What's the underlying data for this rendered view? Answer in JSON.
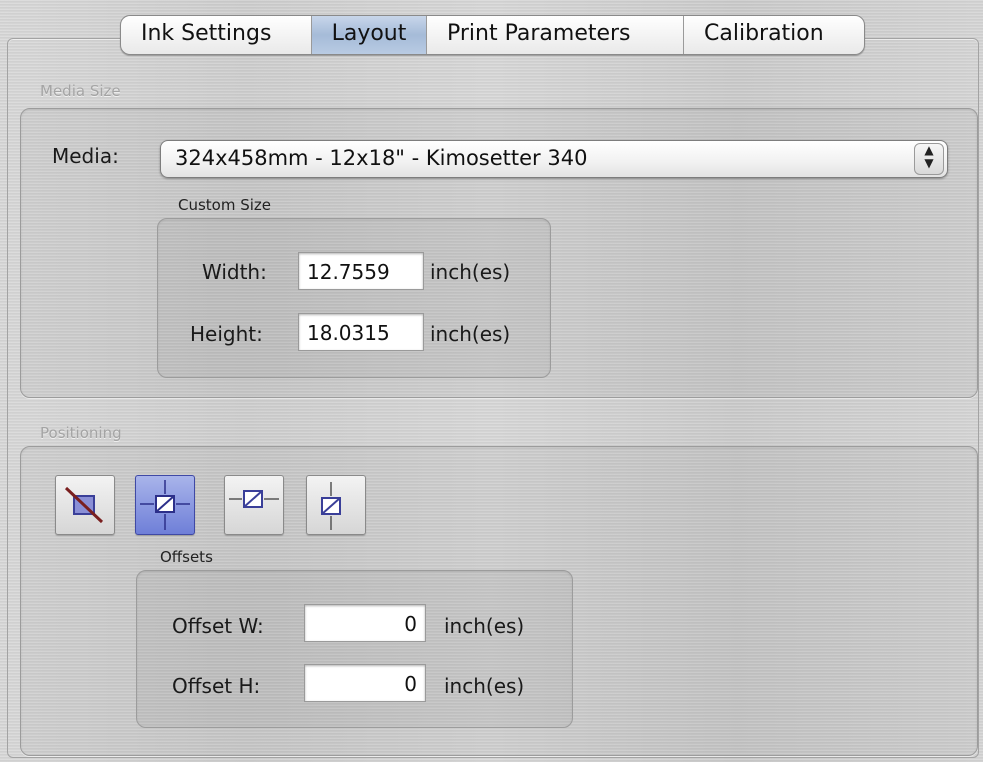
{
  "tabs": [
    {
      "label": "Ink Settings",
      "active": false
    },
    {
      "label": "Layout",
      "active": true
    },
    {
      "label": "Print Parameters",
      "active": false
    },
    {
      "label": "Calibration",
      "active": false
    }
  ],
  "media_size": {
    "group_label": "Media Size",
    "media_label": "Media:",
    "media_value": "324x458mm - 12x18\" - Kimosetter 340",
    "custom_size": {
      "group_label": "Custom Size",
      "width_label": "Width:",
      "width_value": "12.7559",
      "height_label": "Height:",
      "height_value": "18.0315",
      "unit": "inch(es)"
    }
  },
  "positioning": {
    "group_label": "Positioning",
    "buttons": [
      {
        "icon": "no-position-icon",
        "selected": false
      },
      {
        "icon": "center-position-icon",
        "selected": true
      },
      {
        "icon": "center-horizontal-icon",
        "selected": false
      },
      {
        "icon": "center-vertical-icon",
        "selected": false
      }
    ],
    "offsets": {
      "group_label": "Offsets",
      "offset_w_label": "Offset W:",
      "offset_w_value": "0",
      "offset_h_label": "Offset H:",
      "offset_h_value": "0",
      "unit": "inch(es)"
    }
  }
}
